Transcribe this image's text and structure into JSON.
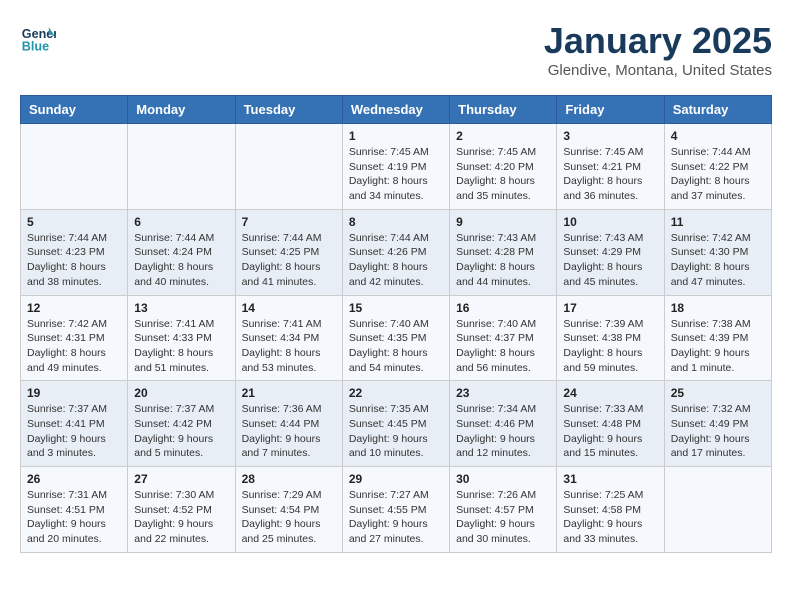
{
  "header": {
    "logo_line1": "General",
    "logo_line2": "Blue",
    "title": "January 2025",
    "subtitle": "Glendive, Montana, United States"
  },
  "days_of_week": [
    "Sunday",
    "Monday",
    "Tuesday",
    "Wednesday",
    "Thursday",
    "Friday",
    "Saturday"
  ],
  "weeks": [
    [
      {
        "day": "",
        "info": ""
      },
      {
        "day": "",
        "info": ""
      },
      {
        "day": "",
        "info": ""
      },
      {
        "day": "1",
        "info": "Sunrise: 7:45 AM\nSunset: 4:19 PM\nDaylight: 8 hours\nand 34 minutes."
      },
      {
        "day": "2",
        "info": "Sunrise: 7:45 AM\nSunset: 4:20 PM\nDaylight: 8 hours\nand 35 minutes."
      },
      {
        "day": "3",
        "info": "Sunrise: 7:45 AM\nSunset: 4:21 PM\nDaylight: 8 hours\nand 36 minutes."
      },
      {
        "day": "4",
        "info": "Sunrise: 7:44 AM\nSunset: 4:22 PM\nDaylight: 8 hours\nand 37 minutes."
      }
    ],
    [
      {
        "day": "5",
        "info": "Sunrise: 7:44 AM\nSunset: 4:23 PM\nDaylight: 8 hours\nand 38 minutes."
      },
      {
        "day": "6",
        "info": "Sunrise: 7:44 AM\nSunset: 4:24 PM\nDaylight: 8 hours\nand 40 minutes."
      },
      {
        "day": "7",
        "info": "Sunrise: 7:44 AM\nSunset: 4:25 PM\nDaylight: 8 hours\nand 41 minutes."
      },
      {
        "day": "8",
        "info": "Sunrise: 7:44 AM\nSunset: 4:26 PM\nDaylight: 8 hours\nand 42 minutes."
      },
      {
        "day": "9",
        "info": "Sunrise: 7:43 AM\nSunset: 4:28 PM\nDaylight: 8 hours\nand 44 minutes."
      },
      {
        "day": "10",
        "info": "Sunrise: 7:43 AM\nSunset: 4:29 PM\nDaylight: 8 hours\nand 45 minutes."
      },
      {
        "day": "11",
        "info": "Sunrise: 7:42 AM\nSunset: 4:30 PM\nDaylight: 8 hours\nand 47 minutes."
      }
    ],
    [
      {
        "day": "12",
        "info": "Sunrise: 7:42 AM\nSunset: 4:31 PM\nDaylight: 8 hours\nand 49 minutes."
      },
      {
        "day": "13",
        "info": "Sunrise: 7:41 AM\nSunset: 4:33 PM\nDaylight: 8 hours\nand 51 minutes."
      },
      {
        "day": "14",
        "info": "Sunrise: 7:41 AM\nSunset: 4:34 PM\nDaylight: 8 hours\nand 53 minutes."
      },
      {
        "day": "15",
        "info": "Sunrise: 7:40 AM\nSunset: 4:35 PM\nDaylight: 8 hours\nand 54 minutes."
      },
      {
        "day": "16",
        "info": "Sunrise: 7:40 AM\nSunset: 4:37 PM\nDaylight: 8 hours\nand 56 minutes."
      },
      {
        "day": "17",
        "info": "Sunrise: 7:39 AM\nSunset: 4:38 PM\nDaylight: 8 hours\nand 59 minutes."
      },
      {
        "day": "18",
        "info": "Sunrise: 7:38 AM\nSunset: 4:39 PM\nDaylight: 9 hours\nand 1 minute."
      }
    ],
    [
      {
        "day": "19",
        "info": "Sunrise: 7:37 AM\nSunset: 4:41 PM\nDaylight: 9 hours\nand 3 minutes."
      },
      {
        "day": "20",
        "info": "Sunrise: 7:37 AM\nSunset: 4:42 PM\nDaylight: 9 hours\nand 5 minutes."
      },
      {
        "day": "21",
        "info": "Sunrise: 7:36 AM\nSunset: 4:44 PM\nDaylight: 9 hours\nand 7 minutes."
      },
      {
        "day": "22",
        "info": "Sunrise: 7:35 AM\nSunset: 4:45 PM\nDaylight: 9 hours\nand 10 minutes."
      },
      {
        "day": "23",
        "info": "Sunrise: 7:34 AM\nSunset: 4:46 PM\nDaylight: 9 hours\nand 12 minutes."
      },
      {
        "day": "24",
        "info": "Sunrise: 7:33 AM\nSunset: 4:48 PM\nDaylight: 9 hours\nand 15 minutes."
      },
      {
        "day": "25",
        "info": "Sunrise: 7:32 AM\nSunset: 4:49 PM\nDaylight: 9 hours\nand 17 minutes."
      }
    ],
    [
      {
        "day": "26",
        "info": "Sunrise: 7:31 AM\nSunset: 4:51 PM\nDaylight: 9 hours\nand 20 minutes."
      },
      {
        "day": "27",
        "info": "Sunrise: 7:30 AM\nSunset: 4:52 PM\nDaylight: 9 hours\nand 22 minutes."
      },
      {
        "day": "28",
        "info": "Sunrise: 7:29 AM\nSunset: 4:54 PM\nDaylight: 9 hours\nand 25 minutes."
      },
      {
        "day": "29",
        "info": "Sunrise: 7:27 AM\nSunset: 4:55 PM\nDaylight: 9 hours\nand 27 minutes."
      },
      {
        "day": "30",
        "info": "Sunrise: 7:26 AM\nSunset: 4:57 PM\nDaylight: 9 hours\nand 30 minutes."
      },
      {
        "day": "31",
        "info": "Sunrise: 7:25 AM\nSunset: 4:58 PM\nDaylight: 9 hours\nand 33 minutes."
      },
      {
        "day": "",
        "info": ""
      }
    ]
  ]
}
